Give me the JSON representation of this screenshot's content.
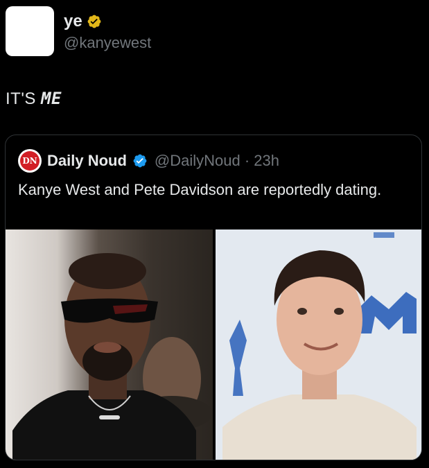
{
  "author": {
    "display_name": "ye",
    "handle": "@kanyewest",
    "verified": "gold-verified-icon"
  },
  "tweet": {
    "text_prefix": "IT'S ",
    "text_stylized": "ME"
  },
  "quoted_tweet": {
    "avatar_initials": "DN",
    "display_name": "Daily Noud",
    "verified": "blue-verified-icon",
    "handle_time": "@DailyNoud · 23h",
    "text": "Kanye West and Pete Davidson are reportedly dating.",
    "photos": [
      {
        "name": "photo-kanye-west"
      },
      {
        "name": "photo-pete-davidson"
      }
    ]
  },
  "colors": {
    "background": "#000000",
    "text_primary": "#e7e9ea",
    "text_secondary": "#71767b",
    "border": "#2f3336",
    "verified_gold": "#e2b719",
    "verified_blue": "#1d9bf0",
    "logo_red": "#d21f26"
  }
}
